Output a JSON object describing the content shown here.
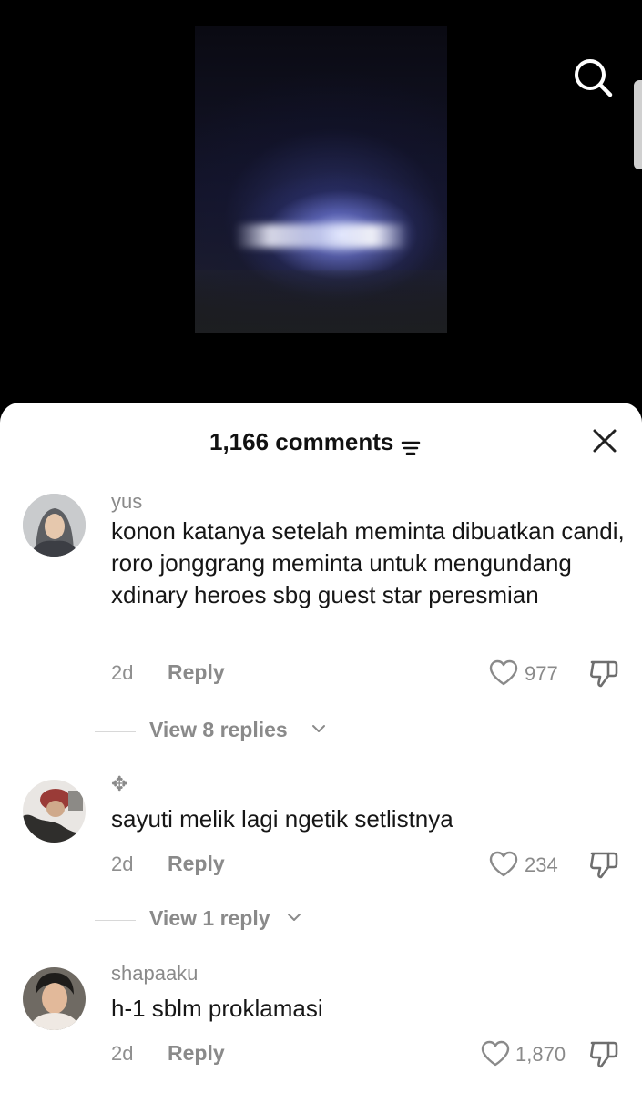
{
  "header": {
    "comments_count": "1,166 comments"
  },
  "icons": {
    "search": "search-icon",
    "sort": "sort-lines-icon",
    "close": "close-icon",
    "like": "heart-outline-icon",
    "dislike": "thumbs-down-icon",
    "chevron": "chevron-down-icon"
  },
  "comments": [
    {
      "username": "yus",
      "text": "konon katanya setelah meminta dibuatkan candi, roro jonggrang meminta untuk mengundang xdinary heroes sbg guest star peresmian",
      "time": "2d",
      "reply_label": "Reply",
      "likes": "977",
      "view_replies": "View 8 replies"
    },
    {
      "username": "✥",
      "text": "sayuti melik lagi ngetik setlistnya",
      "time": "2d",
      "reply_label": "Reply",
      "likes": "234",
      "view_replies": "View 1 reply"
    },
    {
      "username": "shapaaku",
      "text": "h-1 sblm proklamasi",
      "time": "2d",
      "reply_label": "Reply",
      "likes": "1,870"
    }
  ]
}
